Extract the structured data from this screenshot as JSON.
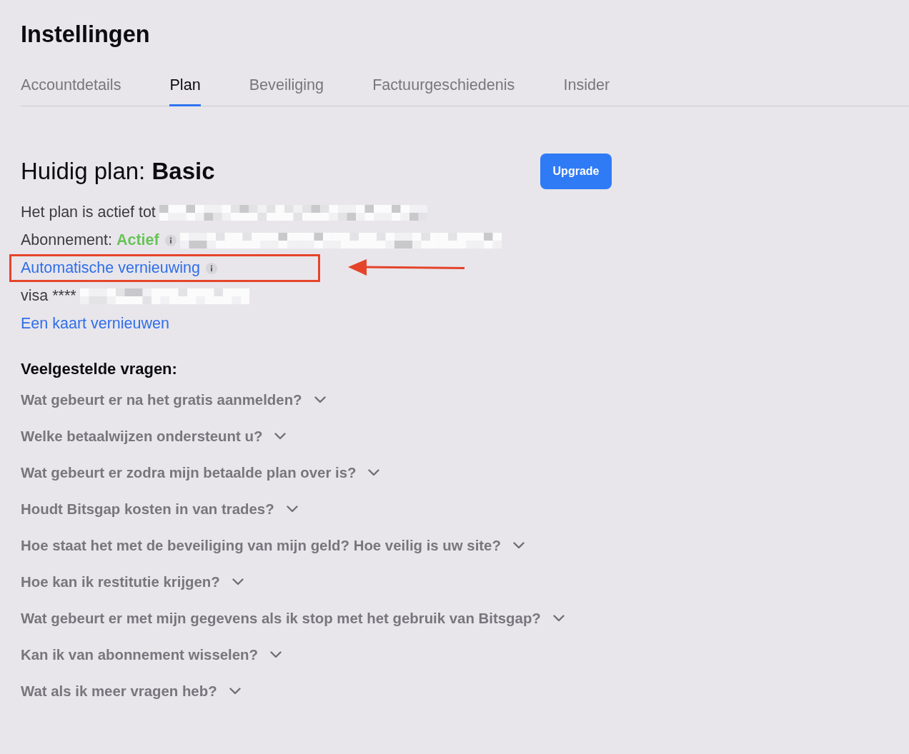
{
  "title": "Instellingen",
  "tabs": [
    {
      "label": "Accountdetails",
      "selected": false
    },
    {
      "label": "Plan",
      "selected": true
    },
    {
      "label": "Beveiliging",
      "selected": false
    },
    {
      "label": "Factuurgeschiedenis",
      "selected": false
    },
    {
      "label": "Insider",
      "selected": false
    }
  ],
  "plan": {
    "heading": "Huidig plan: **Basic**",
    "button": "Upgrade"
  },
  "details": [
    {
      "kind": "text",
      "label": "Het plan is actief tot",
      "redacted": true
    },
    {
      "kind": "status",
      "label": "Abonnement:",
      "status": "Actief",
      "info": true,
      "redacted": true
    },
    {
      "kind": "link",
      "label": "Automatische vernieuwing",
      "info": true,
      "highlighted": true
    },
    {
      "kind": "text",
      "label": "visa ****",
      "redacted": true
    },
    {
      "kind": "link",
      "label": "Een kaart vernieuwen"
    }
  ],
  "faq": {
    "title": "Veelgestelde vragen:",
    "items": [
      {
        "question": "Wat gebeurt er na het gratis aanmelden?",
        "expanded": false
      },
      {
        "question": "Welke betaalwijzen ondersteunt u?",
        "expanded": false
      },
      {
        "question": "Wat gebeurt er zodra mijn betaalde plan over is?",
        "expanded": false
      },
      {
        "question": "Houdt Bitsgap kosten in van trades?",
        "expanded": false
      },
      {
        "question": "Hoe staat het met de beveiliging van mijn geld? Hoe veilig is uw site?",
        "expanded": false
      },
      {
        "question": "Hoe kan ik restitutie krijgen?",
        "expanded": false
      },
      {
        "question": "Wat gebeurt er met mijn gegevens als ik stop met het gebruik van Bitsgap?",
        "expanded": false
      },
      {
        "question": "Kan ik van abonnement wisselen?",
        "expanded": false
      },
      {
        "question": "Wat als ik meer vragen heb?",
        "expanded": false
      }
    ]
  }
}
